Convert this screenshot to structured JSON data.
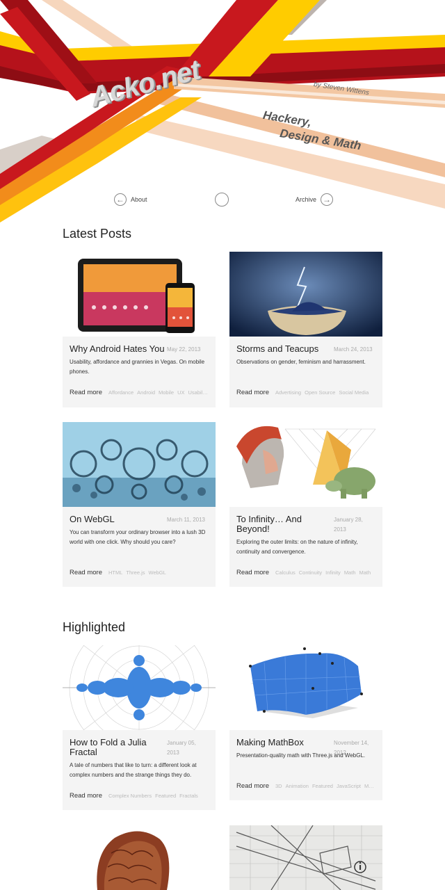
{
  "site": {
    "title": "Acko.net",
    "byline": "by Steven Wittens",
    "tagline_1": "Hackery,",
    "tagline_2": "Design & Math"
  },
  "nav": {
    "about": "About",
    "archive": "Archive"
  },
  "sections": {
    "latest": "Latest Posts",
    "highlighted": "Highlighted"
  },
  "read_more": "Read more",
  "latest": [
    {
      "title": "Why Android Hates You",
      "date": "May 22, 2013",
      "desc": "Usability, affordance and grannies in Vegas. On mobile phones.",
      "tags": [
        "Affordance",
        "Android",
        "Mobile",
        "UX",
        "Usability"
      ]
    },
    {
      "title": "Storms and Teacups",
      "date": "March 24, 2013",
      "desc": "Observations on gender, feminism and harrassment.",
      "tags": [
        "Advertising",
        "Open Source",
        "Social Media"
      ]
    },
    {
      "title": "On WebGL",
      "date": "March 11, 2013",
      "desc": "You can transform your ordinary browser into a lush 3D world with one click. Why should you care?",
      "tags": [
        "HTML",
        "Three.js",
        "WebGL"
      ]
    },
    {
      "title": "To Infinity… And Beyond!",
      "date": "January 28, 2013",
      "desc": "Exploring the outer limits: on the nature of infinity, continuity and convergence.",
      "tags": [
        "Calculus",
        "Continuity",
        "Infinity",
        "Math",
        "Math"
      ]
    }
  ],
  "highlighted": [
    {
      "title": "How to Fold a Julia Fractal",
      "date": "January 05, 2013",
      "desc": "A tale of numbers that like to turn: a different look at complex numbers and the strange things they do.",
      "tags": [
        "Complex Numbers",
        "Featured",
        "Fractals"
      ]
    },
    {
      "title": "Making MathBox",
      "date": "November 14, 2012",
      "desc": "Presentation-quality math with Three.js and WebGL.",
      "tags": [
        "3D",
        "Animation",
        "Featured",
        "JavaScript",
        "Math"
      ]
    }
  ],
  "colors": {
    "red": "#c8181e",
    "yellow": "#ffcc00",
    "orange": "#f59a1b",
    "peach": "#f4c9a6",
    "card_bg": "#f4f4f4"
  }
}
